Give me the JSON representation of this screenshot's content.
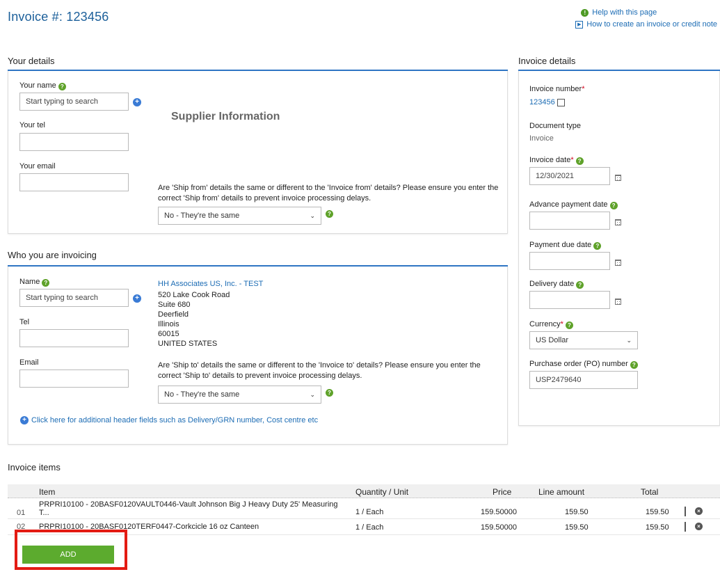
{
  "page": {
    "title": "Invoice #: 123456"
  },
  "help": {
    "help_page": "Help with this page",
    "how_to": "How to create an invoice or credit note"
  },
  "your_details": {
    "title": "Your details",
    "name_label": "Your name",
    "name_placeholder": "Start typing to search",
    "tel_label": "Your tel",
    "tel_value": "",
    "email_label": "Your email",
    "email_value": "",
    "supplier_hint": "Supplier Information",
    "ship_from_question": "Are 'Ship from' details the same or different to the 'Invoice from' details? Please ensure you enter the correct 'Ship from' details to prevent invoice processing delays.",
    "ship_from_select": "No - They're the same"
  },
  "who_invoicing": {
    "title": "Who you are invoicing",
    "name_label": "Name",
    "name_placeholder": "Start typing to search",
    "tel_label": "Tel",
    "email_label": "Email",
    "company": "HH Associates US, Inc. - TEST",
    "address": [
      "520 Lake Cook Road",
      "Suite 680",
      "Deerfield",
      "Illinois",
      "60015",
      "UNITED STATES"
    ],
    "ship_to_question": "Are 'Ship to' details the same or different to the 'Invoice to' details? Please ensure you enter the correct 'Ship to' details to prevent invoice processing delays.",
    "ship_to_select": "No - They're the same",
    "additional_link": "Click here for additional header fields such as Delivery/GRN number, Cost centre etc"
  },
  "invoice_details": {
    "title": "Invoice details",
    "invoice_number_label": "Invoice number",
    "invoice_number_value": "123456",
    "doc_type_label": "Document type",
    "doc_type_value": "Invoice",
    "invoice_date_label": "Invoice date",
    "invoice_date_value": "12/30/2021",
    "advance_payment_label": "Advance payment date",
    "payment_due_label": "Payment due date",
    "delivery_date_label": "Delivery date",
    "currency_label": "Currency",
    "currency_value": "US Dollar",
    "po_label": "Purchase order (PO) number",
    "po_value": "USP2479640"
  },
  "items": {
    "title": "Invoice items",
    "headers": {
      "item": "Item",
      "qty": "Quantity / Unit",
      "price": "Price",
      "line": "Line amount",
      "total": "Total"
    },
    "rows": [
      {
        "num": "01",
        "item": "PRPRI10100 - 20BASF0120VAULT0446-Vault Johnson Big J Heavy Duty 25' Measuring",
        "item2": "T...",
        "qty": "1 / Each",
        "price": "159.50000",
        "line": "159.50",
        "total": "159.50"
      },
      {
        "num": "02",
        "item": "PRPRI10100 - 20BASF0120TERF0447-Corkcicle 16 oz Canteen",
        "item2": "",
        "qty": "1 / Each",
        "price": "159.50000",
        "line": "159.50",
        "total": "159.50"
      }
    ],
    "add_label": "ADD"
  },
  "colors": {
    "accent": "#2f75c4",
    "link": "#1c6cb4",
    "add_button": "#5cab2e",
    "highlight": "#e31b13",
    "help_icon": "#5fa22a"
  }
}
